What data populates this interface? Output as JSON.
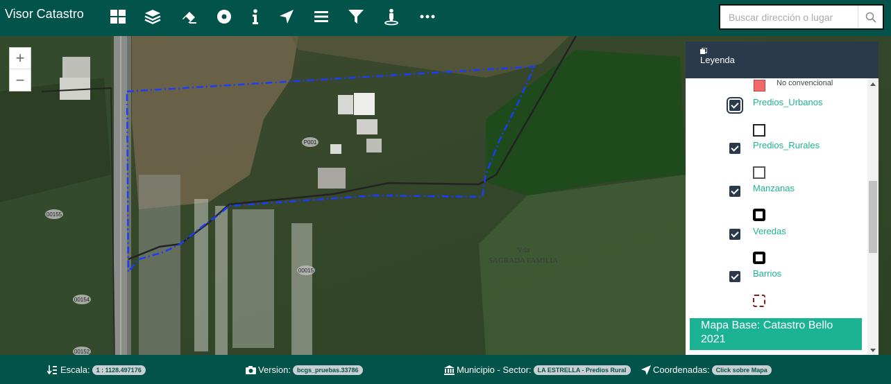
{
  "header": {
    "title": "Visor Catastro",
    "tools": [
      {
        "name": "grid-icon"
      },
      {
        "name": "layers-icon"
      },
      {
        "name": "eraser-icon"
      },
      {
        "name": "circle-dot-icon"
      },
      {
        "name": "info-icon"
      },
      {
        "name": "location-arrow-icon"
      },
      {
        "name": "list-icon"
      },
      {
        "name": "filter-icon"
      },
      {
        "name": "street-view-icon"
      },
      {
        "name": "more-icon"
      }
    ],
    "search": {
      "placeholder": "Buscar dirección o lugar"
    }
  },
  "map": {
    "zoom_in": "+",
    "zoom_out": "−",
    "labels": [
      "P001",
      "00155",
      "00154",
      "00152",
      "00015"
    ],
    "place_label": {
      "line1": "Vda",
      "line2": "SAGRADA FAMILIA"
    }
  },
  "legend": {
    "title": "Leyenda",
    "no_convencional": "No convencional",
    "layers": [
      {
        "label": "Predios_Urbanos",
        "checked": true
      },
      {
        "label": "Predios_Rurales",
        "checked": true
      },
      {
        "label": "Manzanas",
        "checked": true
      },
      {
        "label": "Veredas",
        "checked": true
      },
      {
        "label": "Barrios",
        "checked": true
      }
    ],
    "basemap": "Mapa Base: Catastro Bello 2021"
  },
  "footer": {
    "escala_label": "Escala:",
    "escala_value": "1 : 1128.497176",
    "version_label": "Version:",
    "version_value": "bcgs_pruebas.33786",
    "municipio_label": "Municipio - Sector:",
    "municipio_value": "LA ESTRELLA - Predios Rural",
    "coordenadas_label": "Coordenadas:",
    "coordenadas_value": "Click sobre Mapa"
  },
  "colors": {
    "header_bg": "#02544b",
    "accent": "#1bb394",
    "legend_head": "#2b3a4a",
    "parcel_outline": "#1a3cff"
  }
}
